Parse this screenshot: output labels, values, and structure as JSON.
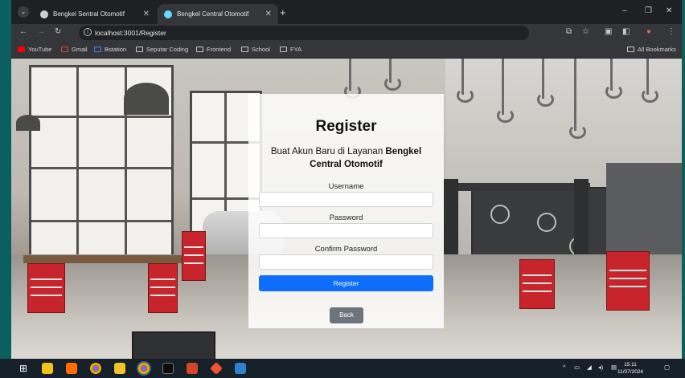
{
  "browser": {
    "tabs": [
      {
        "title": "Bengkel Sentral Otomotif",
        "active": false
      },
      {
        "title": "Bengkel Central Otomotif",
        "active": true
      }
    ],
    "url": "localhost:3001/Register",
    "bookmarks": [
      "YouTube",
      "Gmail",
      "Bstation",
      "Seputar Coding",
      "Frontend",
      "School",
      "FYA"
    ],
    "all_bookmarks": "All Bookmarks"
  },
  "form": {
    "title": "Register",
    "subtitle_prefix": "Buat Akun Baru di Layanan ",
    "subtitle_bold": "Bengkel Central Otomotif",
    "username_label": "Username",
    "password_label": "Password",
    "confirm_label": "Confirm Password",
    "username_value": "",
    "password_value": "",
    "confirm_value": "",
    "register_label": "Register",
    "back_label": "Back"
  },
  "taskbar": {
    "time": "15:11",
    "date": "11/07/2024"
  },
  "colors": {
    "primary_button": "#0d6efd",
    "secondary_button": "#6c757d",
    "desktop_bg": "#0b5f61"
  }
}
